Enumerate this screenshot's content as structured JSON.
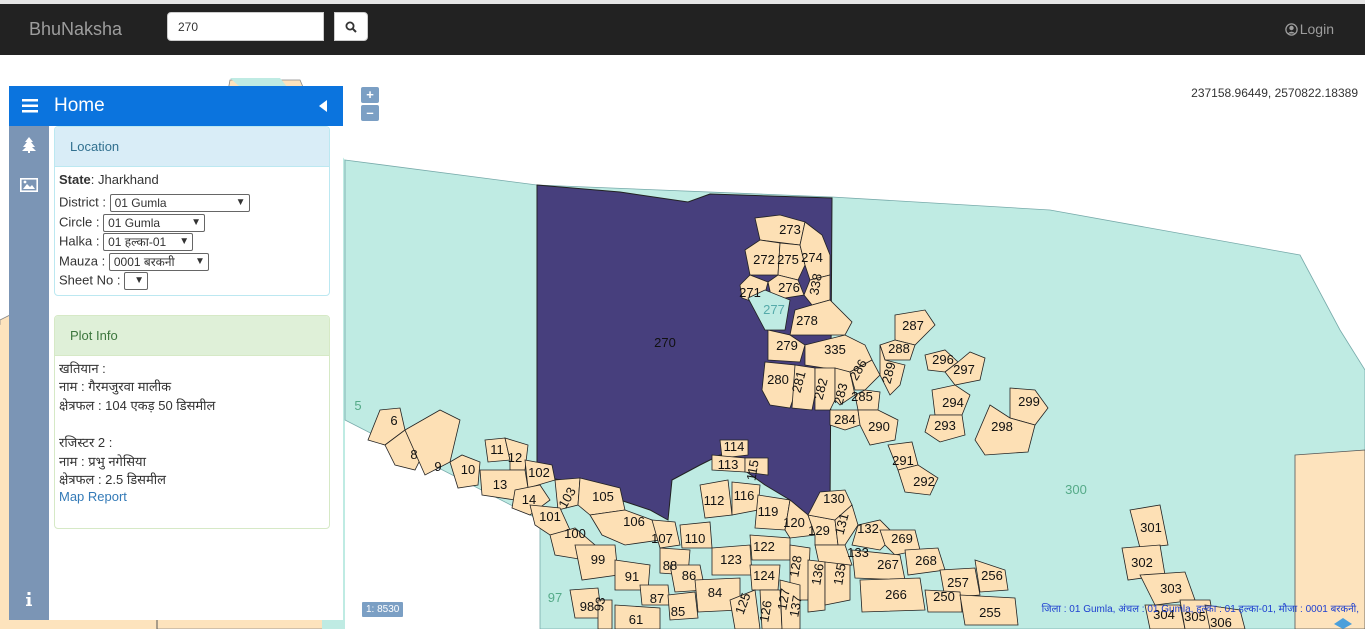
{
  "navbar": {
    "brand": "BhuNaksha",
    "search_value": "270",
    "login_label": "Login"
  },
  "sidebar": {
    "title": "Home",
    "location": {
      "heading": "Location",
      "state_label": "State",
      "state_value": ": Jharkhand",
      "district_label": "District :",
      "district_value": "01 Gumla",
      "circle_label": "Circle :",
      "circle_value": "01 Gumla",
      "halka_label": "Halka :",
      "halka_value": "01 हल्का-01",
      "mauza_label": "Mauza :",
      "mauza_value": "0001 बरकनी",
      "sheet_label": "Sheet No :",
      "sheet_value": ""
    },
    "plot_info": {
      "heading": "Plot Info",
      "line1": "खतियान :",
      "line2": "नाम : गैरमजुरवा मालीक",
      "line3": "क्षेत्रफल : 104 एकड़ 50 डिसमील",
      "line4": "रजिस्टर 2 :",
      "line5": "नाम : प्रभु नगेसिया",
      "line6": "क्षेत्रफल : 2.5 डिसमील",
      "link": "Map Report"
    }
  },
  "map": {
    "coordinates": "237158.96449, 2570822.18389",
    "scale": "1: 8530",
    "footer": "जिला : 01 Gumla, अंचल : 01 Gumla, हल्का : 01 हल्का-01, मौजा : 0001 बरकनी,",
    "zoom_in": "+",
    "zoom_out": "–",
    "selected_plot": "270",
    "colors": {
      "selected": "#473f7d",
      "plot": "#fde0b5",
      "water": "#bfebe3",
      "outer": "#fde3bd"
    },
    "plots": [
      "273",
      "272",
      "275",
      "274",
      "271",
      "276",
      "338",
      "277",
      "278",
      "279",
      "335",
      "287",
      "288",
      "296",
      "297",
      "280",
      "281",
      "282",
      "283",
      "286",
      "289",
      "285",
      "294",
      "299",
      "284",
      "290",
      "293",
      "298",
      "6",
      "8",
      "9",
      "10",
      "11",
      "12",
      "102",
      "13",
      "14",
      "103",
      "105",
      "101",
      "106",
      "100",
      "107",
      "110",
      "112",
      "116",
      "119",
      "120",
      "129",
      "130",
      "131",
      "132",
      "269",
      "99",
      "91",
      "88",
      "86",
      "123",
      "122",
      "133",
      "267",
      "268",
      "87",
      "85",
      "84",
      "124",
      "125",
      "128",
      "126",
      "127",
      "137",
      "136",
      "135",
      "266",
      "257",
      "256",
      "250",
      "255",
      "98",
      "93",
      "61",
      "114",
      "113",
      "115",
      "291",
      "292",
      "300",
      "301",
      "302",
      "303",
      "304",
      "305",
      "306",
      "5",
      "97"
    ]
  }
}
